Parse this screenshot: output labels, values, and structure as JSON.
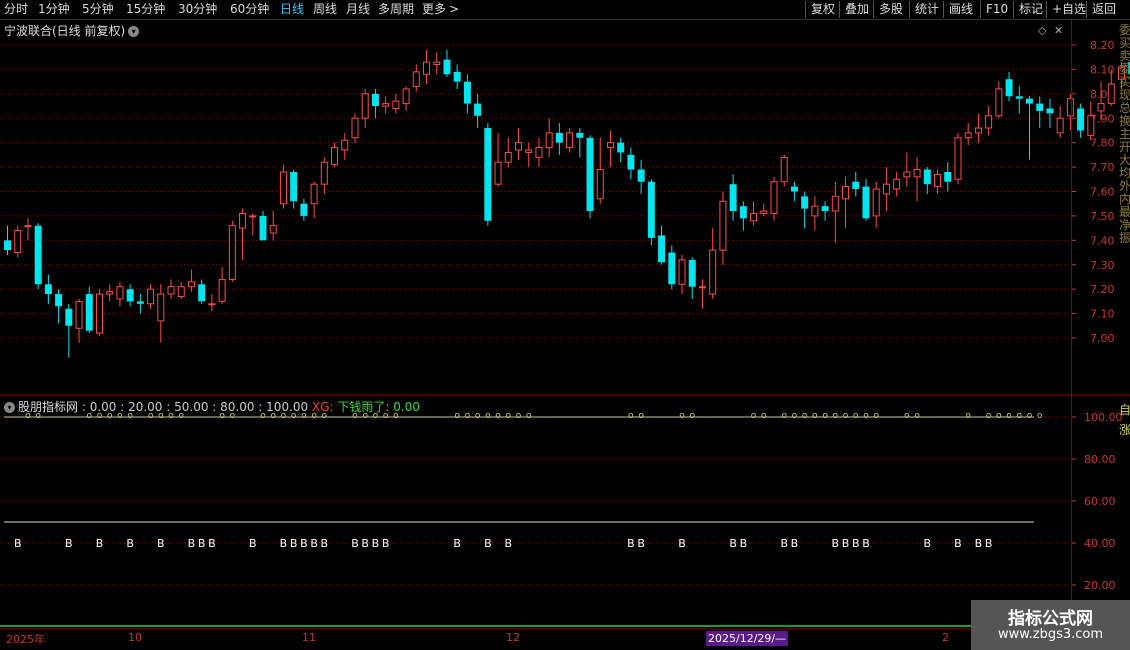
{
  "toolbar": {
    "periods": [
      "分时",
      "1分钟",
      "5分钟",
      "15分钟",
      "30分钟",
      "60分钟",
      "日线",
      "周线",
      "月线",
      "多周期",
      "更多"
    ],
    "active_period": "日线",
    "more_arrow": ">",
    "right_buttons": [
      "复权",
      "叠加",
      "多股",
      "统计",
      "画线",
      "F10",
      "标记",
      "+自选",
      "返回"
    ]
  },
  "header": {
    "title": "宁波联合(日线 前复权)",
    "dropdown_icon": "chevron-down-icon",
    "diamond_icon": "diamond-icon",
    "close_icon": "close-icon"
  },
  "indicator": {
    "name": "股朋指标网",
    "levels_text": ": 0.00 : 20.00 : 50.00 : 80.00 : 100.00",
    "xg_label": "XG:",
    "xg_text": "下钱雨了: 0.00"
  },
  "side_text_top": "委买卖委买现总换主开大均外内最净振",
  "side_text_bottom": "自涨",
  "timeline": {
    "labels": [
      "2025年",
      "10",
      "11",
      "12",
      "2"
    ],
    "cursor_date": "2025/12/29/—"
  },
  "watermark": {
    "line1": "指标公式网",
    "line2": "www.zbgs3.com"
  },
  "colors": {
    "up": "#ff4a4a",
    "down": "#00e5ee",
    "axis": "#8b0000",
    "grid": "#7a0000",
    "label_b": "#ffffff",
    "marker_o": "#d0d060",
    "line100": "#c9c9a0"
  },
  "chart_data": [
    {
      "type": "candlestick",
      "title": "宁波联合(日线 前复权)",
      "ylim": [
        6.88,
        8.24
      ],
      "yticks": [
        7.0,
        7.1,
        7.2,
        7.3,
        7.4,
        7.5,
        7.6,
        7.7,
        7.8,
        7.9,
        8.0,
        8.1,
        8.2
      ],
      "candles": [
        [
          7.4,
          7.36,
          7.46,
          7.34
        ],
        [
          7.35,
          7.44,
          7.46,
          7.33
        ],
        [
          7.46,
          7.46,
          7.49,
          7.4
        ],
        [
          7.46,
          7.22,
          7.47,
          7.2
        ],
        [
          7.22,
          7.18,
          7.26,
          7.14
        ],
        [
          7.18,
          7.13,
          7.2,
          7.06
        ],
        [
          7.12,
          7.05,
          7.14,
          6.92
        ],
        [
          7.04,
          7.15,
          7.16,
          6.98
        ],
        [
          7.18,
          7.03,
          7.21,
          7.02
        ],
        [
          7.02,
          7.18,
          7.2,
          7.01
        ],
        [
          7.18,
          7.19,
          7.22,
          7.15
        ],
        [
          7.16,
          7.21,
          7.23,
          7.13
        ],
        [
          7.2,
          7.15,
          7.22,
          7.13
        ],
        [
          7.15,
          7.14,
          7.18,
          7.1
        ],
        [
          7.14,
          7.2,
          7.22,
          7.12
        ],
        [
          7.07,
          7.18,
          7.22,
          6.98
        ],
        [
          7.18,
          7.21,
          7.24,
          7.16
        ],
        [
          7.17,
          7.21,
          7.23,
          7.16
        ],
        [
          7.21,
          7.23,
          7.28,
          7.19
        ],
        [
          7.22,
          7.15,
          7.24,
          7.14
        ],
        [
          7.14,
          7.14,
          7.18,
          7.11
        ],
        [
          7.15,
          7.24,
          7.29,
          7.14
        ],
        [
          7.24,
          7.46,
          7.48,
          7.23
        ],
        [
          7.45,
          7.51,
          7.53,
          7.32
        ],
        [
          7.5,
          7.5,
          7.51,
          7.42
        ],
        [
          7.5,
          7.4,
          7.52,
          7.4
        ],
        [
          7.43,
          7.46,
          7.52,
          7.4
        ],
        [
          7.55,
          7.68,
          7.71,
          7.53
        ],
        [
          7.68,
          7.56,
          7.69,
          7.53
        ],
        [
          7.55,
          7.5,
          7.57,
          7.48
        ],
        [
          7.55,
          7.63,
          7.64,
          7.49
        ],
        [
          7.63,
          7.72,
          7.74,
          7.59
        ],
        [
          7.71,
          7.78,
          7.8,
          7.7
        ],
        [
          7.77,
          7.81,
          7.84,
          7.73
        ],
        [
          7.82,
          7.9,
          7.92,
          7.8
        ],
        [
          7.9,
          8.0,
          8.02,
          7.86
        ],
        [
          8.0,
          7.95,
          8.02,
          7.9
        ],
        [
          7.95,
          7.96,
          7.99,
          7.92
        ],
        [
          7.94,
          7.97,
          8.0,
          7.92
        ],
        [
          7.96,
          8.02,
          8.03,
          7.93
        ],
        [
          8.03,
          8.09,
          8.12,
          8.01
        ],
        [
          8.08,
          8.13,
          8.18,
          8.04
        ],
        [
          8.12,
          8.13,
          8.17,
          8.08
        ],
        [
          8.14,
          8.08,
          8.18,
          8.07
        ],
        [
          8.09,
          8.05,
          8.12,
          8.02
        ],
        [
          8.05,
          7.96,
          8.08,
          7.92
        ],
        [
          7.96,
          7.91,
          8.0,
          7.86
        ],
        [
          7.86,
          7.48,
          7.88,
          7.46
        ],
        [
          7.63,
          7.72,
          7.84,
          7.62
        ],
        [
          7.72,
          7.76,
          7.82,
          7.7
        ],
        [
          7.77,
          7.8,
          7.86,
          7.73
        ],
        [
          7.76,
          7.77,
          7.8,
          7.7
        ],
        [
          7.74,
          7.78,
          7.82,
          7.7
        ],
        [
          7.78,
          7.84,
          7.9,
          7.74
        ],
        [
          7.84,
          7.8,
          7.88,
          7.75
        ],
        [
          7.78,
          7.84,
          7.86,
          7.76
        ],
        [
          7.84,
          7.82,
          7.86,
          7.74
        ],
        [
          7.82,
          7.52,
          7.83,
          7.49
        ],
        [
          7.57,
          7.69,
          7.82,
          7.55
        ],
        [
          7.78,
          7.8,
          7.85,
          7.7
        ],
        [
          7.8,
          7.76,
          7.82,
          7.72
        ],
        [
          7.75,
          7.69,
          7.78,
          7.65
        ],
        [
          7.69,
          7.64,
          7.73,
          7.59
        ],
        [
          7.64,
          7.41,
          7.65,
          7.38
        ],
        [
          7.42,
          7.31,
          7.46,
          7.3
        ],
        [
          7.35,
          7.22,
          7.38,
          7.2
        ],
        [
          7.22,
          7.32,
          7.34,
          7.18
        ],
        [
          7.32,
          7.21,
          7.33,
          7.16
        ],
        [
          7.21,
          7.21,
          7.24,
          7.12
        ],
        [
          7.18,
          7.36,
          7.45,
          7.16
        ],
        [
          7.36,
          7.56,
          7.6,
          7.3
        ],
        [
          7.63,
          7.52,
          7.67,
          7.48
        ],
        [
          7.54,
          7.49,
          7.56,
          7.44
        ],
        [
          7.48,
          7.51,
          7.56,
          7.46
        ],
        [
          7.51,
          7.52,
          7.55,
          7.5
        ],
        [
          7.51,
          7.64,
          7.66,
          7.48
        ],
        [
          7.64,
          7.74,
          7.75,
          7.62
        ],
        [
          7.62,
          7.6,
          7.64,
          7.56
        ],
        [
          7.58,
          7.53,
          7.6,
          7.45
        ],
        [
          7.5,
          7.54,
          7.58,
          7.44
        ],
        [
          7.54,
          7.52,
          7.56,
          7.48
        ],
        [
          7.52,
          7.58,
          7.64,
          7.39
        ],
        [
          7.57,
          7.62,
          7.66,
          7.45
        ],
        [
          7.64,
          7.61,
          7.68,
          7.58
        ],
        [
          7.62,
          7.49,
          7.65,
          7.48
        ],
        [
          7.5,
          7.61,
          7.64,
          7.45
        ],
        [
          7.59,
          7.63,
          7.7,
          7.52
        ],
        [
          7.61,
          7.65,
          7.68,
          7.58
        ],
        [
          7.66,
          7.68,
          7.76,
          7.62
        ],
        [
          7.66,
          7.69,
          7.74,
          7.56
        ],
        [
          7.69,
          7.63,
          7.7,
          7.59
        ],
        [
          7.62,
          7.67,
          7.69,
          7.59
        ],
        [
          7.68,
          7.64,
          7.72,
          7.6
        ],
        [
          7.65,
          7.82,
          7.84,
          7.63
        ],
        [
          7.82,
          7.84,
          7.88,
          7.79
        ],
        [
          7.84,
          7.86,
          7.92,
          7.8
        ],
        [
          7.86,
          7.91,
          7.95,
          7.83
        ],
        [
          7.91,
          8.02,
          8.05,
          7.9
        ],
        [
          8.06,
          7.99,
          8.09,
          7.97
        ],
        [
          7.99,
          7.98,
          8.03,
          7.92
        ],
        [
          7.98,
          7.96,
          7.99,
          7.73
        ],
        [
          7.96,
          7.93,
          7.99,
          7.86
        ],
        [
          7.94,
          7.92,
          7.98,
          7.86
        ],
        [
          7.84,
          7.9,
          7.95,
          7.82
        ],
        [
          7.91,
          7.98,
          8.0,
          7.85
        ],
        [
          7.94,
          7.85,
          7.96,
          7.82
        ],
        [
          7.83,
          7.91,
          7.97,
          7.81
        ],
        [
          7.93,
          7.96,
          8.05,
          7.89
        ],
        [
          7.96,
          8.04,
          8.1,
          7.95
        ],
        [
          8.06,
          8.11,
          8.13,
          8.02
        ],
        [
          8.13,
          8.08,
          8.15,
          8.06
        ],
        [
          8.06,
          8.15,
          8.18,
          8.0
        ],
        [
          8.15,
          8.18,
          8.22,
          8.12
        ],
        [
          8.18,
          8.18,
          8.21,
          8.16
        ],
        [
          8.18,
          8.12,
          8.2,
          8.1
        ],
        [
          8.13,
          7.98,
          8.14,
          7.96
        ],
        [
          8.03,
          8.02,
          8.1,
          7.99
        ]
      ]
    },
    {
      "type": "indicator",
      "title": "股朋指标网",
      "ylim": [
        0,
        105
      ],
      "yticks": [
        20.0,
        40.0,
        60.0,
        80.0,
        100.0
      ],
      "levels": [
        0,
        20,
        50,
        80,
        100
      ],
      "xg": 0.0,
      "b_signals_at_40": [
        1,
        6,
        9,
        12,
        15,
        18,
        19,
        20,
        24,
        27,
        28,
        29,
        30,
        31,
        34,
        35,
        36,
        37,
        44,
        47,
        49,
        61,
        62,
        66,
        71,
        72,
        76,
        77,
        81,
        82,
        83,
        84,
        90,
        93,
        95,
        96
      ],
      "o_markers_at_100": [
        2,
        3,
        8,
        9,
        10,
        11,
        12,
        14,
        15,
        16,
        17,
        21,
        22,
        25,
        26,
        27,
        28,
        29,
        30,
        31,
        34,
        35,
        36,
        37,
        38,
        44,
        45,
        46,
        47,
        48,
        49,
        50,
        51,
        61,
        62,
        66,
        67,
        73,
        74,
        76,
        77,
        78,
        79,
        80,
        81,
        82,
        83,
        84,
        85,
        88,
        89,
        94,
        96,
        97,
        98,
        99,
        100,
        101
      ]
    }
  ]
}
